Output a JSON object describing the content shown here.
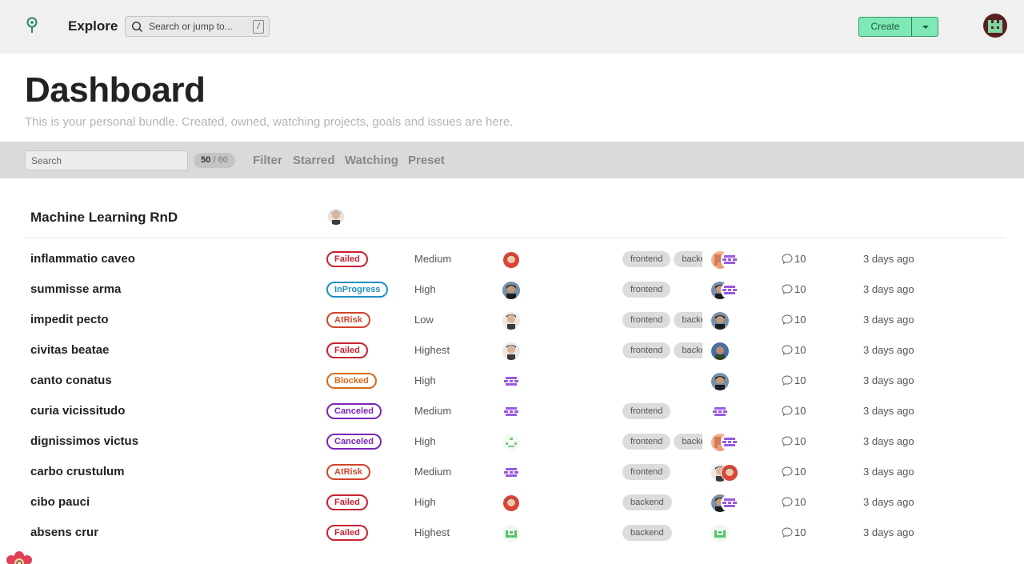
{
  "header": {
    "app_title": "Explore",
    "search_placeholder": "Search or jump to...",
    "search_shortcut": "/",
    "create_label": "Create",
    "logo_icon": "tree-logo-icon",
    "accent_color": "#7ee8b6"
  },
  "page": {
    "title": "Dashboard",
    "subtitle": "This is your personal bundle. Created, owned, watching projects, goals and issues are here."
  },
  "filters": {
    "search_placeholder": "Search",
    "count_current": "50",
    "count_separator": " / ",
    "count_total": "60",
    "links": [
      "Filter",
      "Starred",
      "Watching",
      "Preset"
    ]
  },
  "project": {
    "name": "Machine Learning RnD"
  },
  "rows": [
    {
      "title": "inflammatio caveo",
      "status": "Failed",
      "priority": "Medium",
      "tags": [
        "frontend",
        "backend"
      ],
      "comments": "10",
      "time": "3 days ago"
    },
    {
      "title": "summisse arma",
      "status": "InProgress",
      "priority": "High",
      "tags": [
        "frontend"
      ],
      "comments": "10",
      "time": "3 days ago"
    },
    {
      "title": "impedit pecto",
      "status": "AtRisk",
      "priority": "Low",
      "tags": [
        "frontend",
        "backend"
      ],
      "comments": "10",
      "time": "3 days ago"
    },
    {
      "title": "civitas beatae",
      "status": "Failed",
      "priority": "Highest",
      "tags": [
        "frontend",
        "backend"
      ],
      "comments": "10",
      "time": "3 days ago"
    },
    {
      "title": "canto conatus",
      "status": "Blocked",
      "priority": "High",
      "tags": [],
      "comments": "10",
      "time": "3 days ago"
    },
    {
      "title": "curia vicissitudo",
      "status": "Canceled",
      "priority": "Medium",
      "tags": [
        "frontend"
      ],
      "comments": "10",
      "time": "3 days ago"
    },
    {
      "title": "dignissimos victus",
      "status": "Canceled",
      "priority": "High",
      "tags": [
        "frontend",
        "backend"
      ],
      "comments": "10",
      "time": "3 days ago"
    },
    {
      "title": "carbo crustulum",
      "status": "AtRisk",
      "priority": "Medium",
      "tags": [
        "frontend"
      ],
      "comments": "10",
      "time": "3 days ago"
    },
    {
      "title": "cibo pauci",
      "status": "Failed",
      "priority": "High",
      "tags": [
        "backend"
      ],
      "comments": "10",
      "time": "3 days ago"
    },
    {
      "title": "absens crur",
      "status": "Failed",
      "priority": "Highest",
      "tags": [
        "backend"
      ],
      "comments": "10",
      "time": "3 days ago"
    }
  ],
  "avatar_kinds": {
    "assignees": [
      "photo-red",
      "photo-dark",
      "photo-gray",
      "photo-gray",
      "pixel-purple",
      "pixel-purple",
      "pixel-green-dots",
      "pixel-purple",
      "photo-red",
      "pixel-green"
    ],
    "watchers": [
      [
        "photo-peach",
        "pixel-purple"
      ],
      [
        "photo-dark",
        "pixel-purple"
      ],
      [
        "photo-dark"
      ],
      [
        "photo-blue"
      ],
      [
        "photo-dark"
      ],
      [
        "pixel-purple"
      ],
      [
        "photo-peach",
        "pixel-purple"
      ],
      [
        "photo-gray",
        "photo-red"
      ],
      [
        "photo-dark",
        "pixel-purple"
      ],
      [
        "pixel-green"
      ]
    ]
  },
  "status_colors": {
    "Failed": "#c82333",
    "InProgress": "#1f8fc2",
    "AtRisk": "#d0452a",
    "Blocked": "#d86a18",
    "Canceled": "#7b26b8"
  }
}
